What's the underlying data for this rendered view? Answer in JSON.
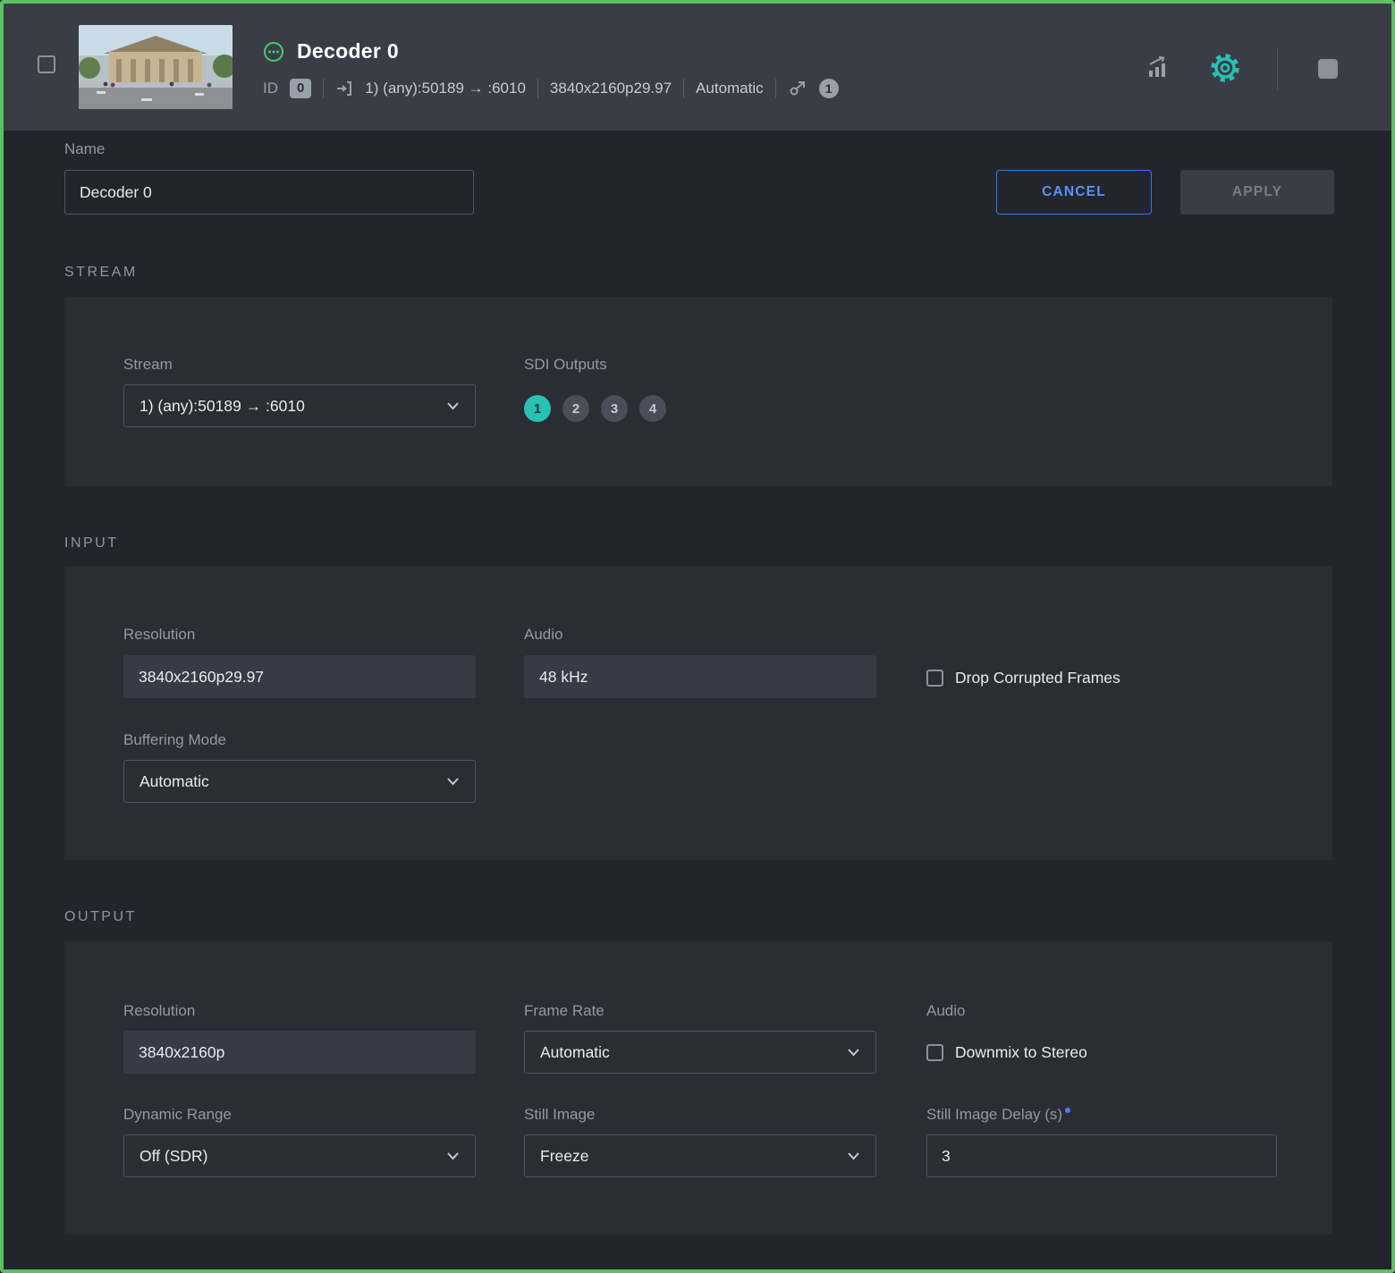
{
  "colors": {
    "accent_green": "#5ebf63",
    "accent_teal": "#27c2b4",
    "accent_blue": "#2e7bf3",
    "header_bg": "#3a3d46",
    "panel_bg": "#2b2d35",
    "page_bg": "#23252d"
  },
  "header": {
    "title": "Decoder 0",
    "id_label": "ID",
    "id_badge": "0",
    "stream_info": "1) (any):50189 → :6010",
    "resolution": "3840x2160p29.97",
    "mode": "Automatic",
    "output_badge": "1"
  },
  "name_form": {
    "label": "Name",
    "value": "Decoder 0",
    "cancel": "CANCEL",
    "apply": "APPLY"
  },
  "stream": {
    "heading": "STREAM",
    "stream_label": "Stream",
    "stream_value": "1) (any):50189 → :6010",
    "sdi_label": "SDI Outputs",
    "sdi_outputs": [
      "1",
      "2",
      "3",
      "4"
    ],
    "sdi_active": "1"
  },
  "input": {
    "heading": "INPUT",
    "resolution_label": "Resolution",
    "resolution_value": "3840x2160p29.97",
    "audio_label": "Audio",
    "audio_value": "48 kHz",
    "drop_corrupted_label": "Drop Corrupted Frames",
    "buffering_label": "Buffering Mode",
    "buffering_value": "Automatic"
  },
  "output": {
    "heading": "OUTPUT",
    "resolution_label": "Resolution",
    "resolution_value": "3840x2160p",
    "frame_rate_label": "Frame Rate",
    "frame_rate_value": "Automatic",
    "audio_label": "Audio",
    "downmix_label": "Downmix to Stereo",
    "dynamic_range_label": "Dynamic Range",
    "dynamic_range_value": "Off (SDR)",
    "still_image_label": "Still Image",
    "still_image_value": "Freeze",
    "still_delay_label": "Still Image Delay (s)",
    "still_delay_value": "3"
  }
}
